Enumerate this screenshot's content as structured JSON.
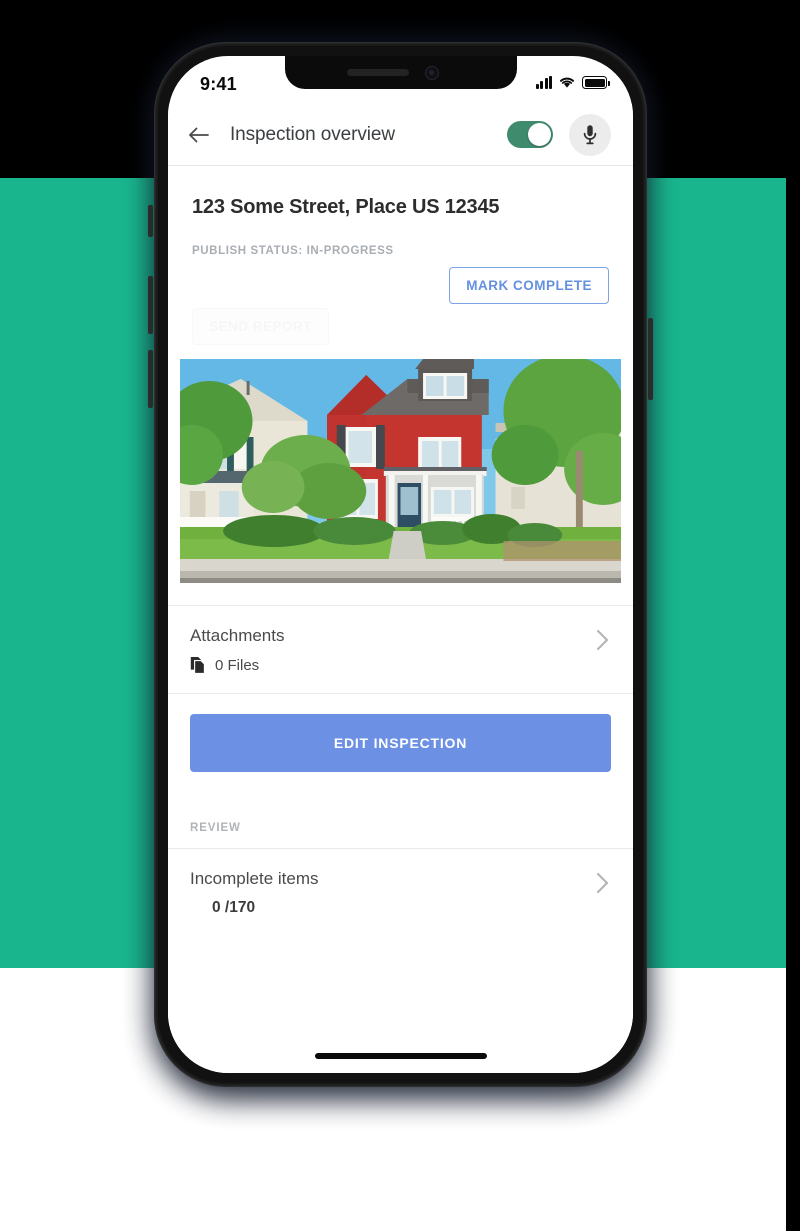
{
  "colors": {
    "page_background": "#19b68d",
    "accent_blue": "#6c90e4",
    "outline_blue": "#7ba5e8",
    "toggle_green": "#3f8b6e",
    "muted_gray": "#a9aeb3"
  },
  "status_bar": {
    "time": "9:41",
    "signal_icon": "signal-bars-icon",
    "wifi_icon": "wifi-icon",
    "battery_icon": "battery-full-icon"
  },
  "app_bar": {
    "back_icon": "back-arrow-icon",
    "title": "Inspection overview",
    "toggle_state": "on",
    "mic_icon": "microphone-icon"
  },
  "inspection": {
    "address": "123 Some Street, Place US 12345",
    "publish_status": "PUBLISH STATUS: IN-PROGRESS",
    "mark_complete_label": "MARK COMPLETE",
    "send_report_label": "SEND REPORT",
    "send_report_enabled": false,
    "photo_alt": "Red two-story house front exterior"
  },
  "attachments": {
    "title": "Attachments",
    "files_icon": "files-icon",
    "files_count": "0 Files",
    "chevron_icon": "chevron-right-icon"
  },
  "primary_action": {
    "edit_inspection_label": "EDIT INSPECTION"
  },
  "review": {
    "section_label": "REVIEW",
    "incomplete_title": "Incomplete items",
    "incomplete_count": "0 /170",
    "chevron_icon": "chevron-right-icon"
  },
  "home_indicator": "home-indicator"
}
